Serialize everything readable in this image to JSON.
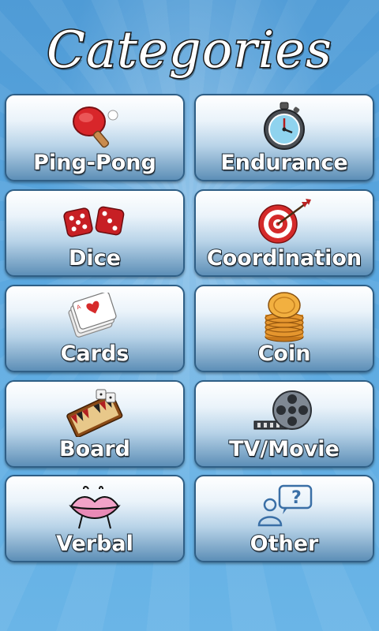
{
  "title": "Categories",
  "categories": [
    {
      "label": "Ping-Pong",
      "icon": "ping-pong-paddle-icon"
    },
    {
      "label": "Endurance",
      "icon": "stopwatch-icon"
    },
    {
      "label": "Dice",
      "icon": "dice-icon"
    },
    {
      "label": "Coordination",
      "icon": "target-icon"
    },
    {
      "label": "Cards",
      "icon": "playing-cards-icon"
    },
    {
      "label": "Coin",
      "icon": "coins-icon"
    },
    {
      "label": "Board",
      "icon": "backgammon-board-icon"
    },
    {
      "label": "TV/Movie",
      "icon": "film-reel-icon"
    },
    {
      "label": "Verbal",
      "icon": "lips-icon"
    },
    {
      "label": "Other",
      "icon": "question-chat-icon"
    }
  ],
  "colors": {
    "background": "#5aa7df",
    "tile_border": "#2f5f86",
    "label_text": "#ffffff"
  }
}
